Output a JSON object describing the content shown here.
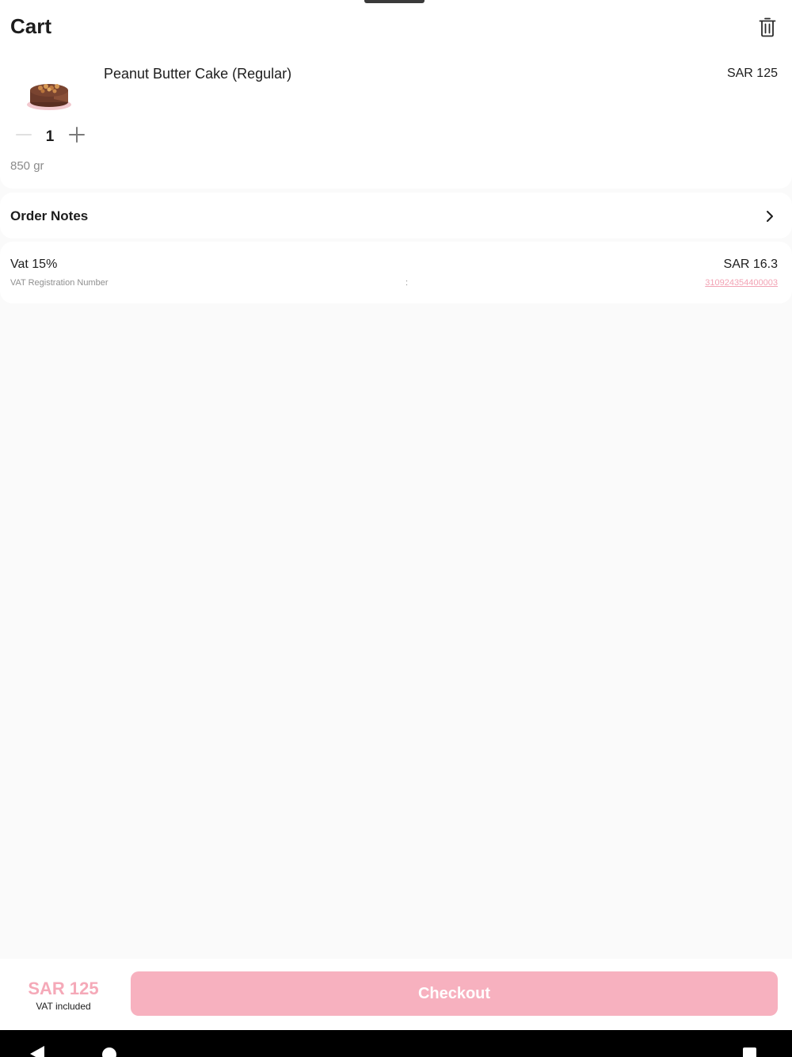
{
  "header": {
    "title": "Cart",
    "clear_icon": "trash-icon"
  },
  "cart": {
    "items": [
      {
        "name": "Peanut Butter Cake (Regular)",
        "price": "SAR 125",
        "quantity": "1",
        "weight": "850 gr",
        "image_icon": "cake-image"
      }
    ]
  },
  "order_notes": {
    "label": "Order Notes",
    "icon": "chevron-right-icon"
  },
  "vat": {
    "label": "Vat 15%",
    "amount": "SAR 16.3",
    "registration_label": "VAT Registration Number",
    "separator": ":",
    "registration_number": "310924354400003"
  },
  "footer": {
    "total": "SAR 125",
    "total_note": "VAT included",
    "checkout_label": "Checkout"
  },
  "colors": {
    "accent": "#f7b1bf",
    "accent_text": "#f5a9b8",
    "link": "#f2a3b4"
  }
}
